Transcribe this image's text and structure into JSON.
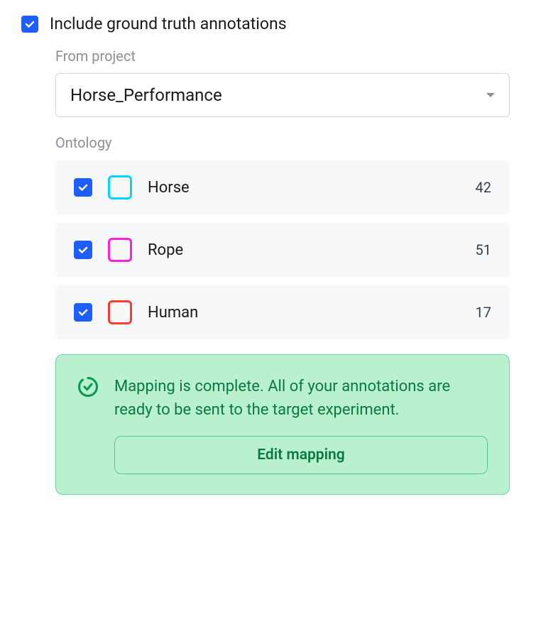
{
  "header": {
    "title": "Include ground truth annotations",
    "checked": true
  },
  "project": {
    "label": "From project",
    "selected": "Horse_Performance"
  },
  "ontology": {
    "label": "Ontology",
    "items": [
      {
        "name": "Horse",
        "count": "42",
        "color": "#00d4ff",
        "checked": true
      },
      {
        "name": "Rope",
        "count": "51",
        "color": "#ff1fd6",
        "checked": true
      },
      {
        "name": "Human",
        "count": "17",
        "color": "#ff3b30",
        "checked": true
      }
    ]
  },
  "status": {
    "message": "Mapping is complete. All of your annotations are ready to be sent to the target experiment.",
    "button": "Edit mapping"
  }
}
